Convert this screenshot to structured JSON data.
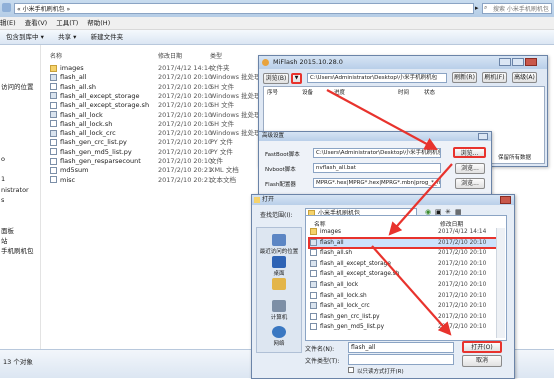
{
  "explorer": {
    "address": "« 小米手机刷机包 »",
    "search_placeholder": "搜索 小米手机刷机包",
    "menu": [
      "辑(E)",
      "查看(V)",
      "工具(T)",
      "帮助(H)"
    ],
    "commands": [
      "包含到库中 ▾",
      "共享 ▾",
      "新建文件夹"
    ],
    "nav_items": [
      "",
      "",
      "访问的位置",
      "",
      "",
      "",
      "",
      "",
      "",
      "o",
      "",
      "1",
      "nistrator",
      "s",
      "",
      "",
      "面板",
      "站",
      "手机刷机包"
    ],
    "columns": {
      "name": "名称",
      "date": "修改日期",
      "type": "类型"
    },
    "files": [
      {
        "name": "images",
        "date": "2017/4/12 14:14",
        "type": "文件夹",
        "icon": "folder"
      },
      {
        "name": "flash_all",
        "date": "2017/2/10 20:10",
        "type": "Windows 批处理...",
        "icon": "batch"
      },
      {
        "name": "flash_all.sh",
        "date": "2017/2/10 20:10",
        "type": "SH 文件",
        "icon": "file"
      },
      {
        "name": "flash_all_except_storage",
        "date": "2017/2/10 20:10",
        "type": "Windows 批处理...",
        "icon": "batch"
      },
      {
        "name": "flash_all_except_storage.sh",
        "date": "2017/2/10 20:10",
        "type": "SH 文件",
        "icon": "file"
      },
      {
        "name": "flash_all_lock",
        "date": "2017/2/10 20:10",
        "type": "Windows 批处理...",
        "icon": "batch"
      },
      {
        "name": "flash_all_lock.sh",
        "date": "2017/2/10 20:10",
        "type": "SH 文件",
        "icon": "file"
      },
      {
        "name": "flash_all_lock_crc",
        "date": "2017/2/10 20:10",
        "type": "Windows 批处理...",
        "icon": "batch"
      },
      {
        "name": "flash_gen_crc_list.py",
        "date": "2017/2/10 20:10",
        "type": "PY 文件",
        "icon": "file"
      },
      {
        "name": "flash_gen_md5_list.py",
        "date": "2017/2/10 20:10",
        "type": "PY 文件",
        "icon": "file"
      },
      {
        "name": "flash_gen_resparsecount",
        "date": "2017/2/10 20:10",
        "type": "文件",
        "icon": "file"
      },
      {
        "name": "md5sum",
        "date": "2017/2/10 20:21",
        "type": "XML 文档",
        "icon": "file"
      },
      {
        "name": "misc",
        "date": "2017/2/10 20:21",
        "type": "文本文档",
        "icon": "file"
      }
    ],
    "status": "13 个对象"
  },
  "miflash": {
    "title": "MiFlash 2015.10.28.0",
    "browse_label": "浏览(B)",
    "path": "C:\\Users\\Administrator\\Desktop\\小米手机刷机包",
    "refresh_label": "刷新(R)",
    "flash_label": "刷机(F)",
    "advanced_label": "高级(A)",
    "columns": [
      "序号",
      "设备",
      "进度",
      "时间",
      "状态"
    ],
    "side_text": "保留所有数据"
  },
  "settings": {
    "title": "高级设置",
    "rows": [
      {
        "label": "FastBoot脚本",
        "value": "C:\\Users\\Administrator\\Desktop\\小米手机刷机包\\flash_...",
        "button": "浏览..."
      },
      {
        "label": "Nvboot脚本",
        "value": "nvflash_all.bat",
        "button": "浏览..."
      },
      {
        "label": "Flash配置器",
        "value": "MPRG*.hex|MPRG*.hex|MPRG*.mbn|prog_*_firehose_*.*",
        "button": "浏览..."
      }
    ]
  },
  "open_dialog": {
    "title": "打开",
    "lookin_label": "查找范围(I):",
    "lookin_value": "小米手机刷机包",
    "col_name": "名称",
    "col_date": "修改日期",
    "places": [
      "最近访问的位置",
      "桌面",
      "",
      "计算机",
      "网络"
    ],
    "files": [
      {
        "name": "images",
        "date": "2017/4/12 14:14",
        "icon": "folder"
      },
      {
        "name": "flash_all",
        "date": "2017/2/10 20:10",
        "icon": "batch"
      },
      {
        "name": "flash_all.sh",
        "date": "2017/2/10 20:10",
        "icon": "file"
      },
      {
        "name": "flash_all_except_storage",
        "date": "2017/2/10 20:10",
        "icon": "batch"
      },
      {
        "name": "flash_all_except_storage.sh",
        "date": "2017/2/10 20:10",
        "icon": "file"
      },
      {
        "name": "flash_all_lock",
        "date": "2017/2/10 20:10",
        "icon": "batch"
      },
      {
        "name": "flash_all_lock.sh",
        "date": "2017/2/10 20:10",
        "icon": "file"
      },
      {
        "name": "flash_all_lock_crc",
        "date": "2017/2/10 20:10",
        "icon": "batch"
      },
      {
        "name": "flash_gen_crc_list.py",
        "date": "2017/2/10 20:10",
        "icon": "file"
      },
      {
        "name": "flash_gen_md5_list.py",
        "date": "2017/2/10 20:10",
        "icon": "file"
      }
    ],
    "filename_label": "文件名(N):",
    "filename_value": "flash_all",
    "filetype_label": "文件类型(T):",
    "open_label": "打开(O)",
    "cancel_label": "取消",
    "readonly_label": "以只读方式打开(R)"
  },
  "colors": {
    "highlight": "#e8332d",
    "accent": "#3c6fb3",
    "selection": "#cce1fb"
  }
}
